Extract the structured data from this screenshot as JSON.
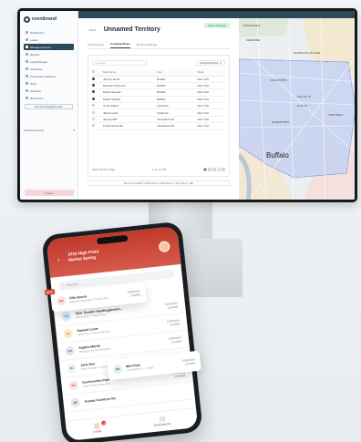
{
  "app": {
    "brand": "eventbrand",
    "sidebar_items": [
      {
        "label": "Dashboard",
        "active": false
      },
      {
        "label": "Leads",
        "active": false
      },
      {
        "label": "Manage Account",
        "active": true
      },
      {
        "label": "Reports",
        "active": false
      },
      {
        "label": "Lead Manager",
        "active": false
      },
      {
        "label": "Attendees",
        "active": false
      },
      {
        "label": "Processed Invitations",
        "active": false
      },
      {
        "label": "Tests",
        "active": false
      },
      {
        "label": "Activities",
        "active": false
      },
      {
        "label": "Resources",
        "active": false
      }
    ],
    "sidebar_button": "Set Up Integration Hub",
    "sidebar_select": "Switch Accounts",
    "logout_label": "Logout",
    "back_label": "< Back",
    "page_title": "Unnamed Territory",
    "save_label": "Save Changes",
    "tabs": [
      {
        "label": "Territory Area",
        "active": false
      },
      {
        "label": "Assigned Reps",
        "active": true
      },
      {
        "label": "Territory Settings",
        "active": false
      }
    ],
    "search_placeholder": "Search",
    "filter_label": "Assigned Reps",
    "columns": [
      "Rep Name",
      "City",
      "State"
    ],
    "rows": [
      {
        "checked": true,
        "name": "Jeremy Smith",
        "city": "Buffalo",
        "state": "New York"
      },
      {
        "checked": true,
        "name": "Brandon Simmons",
        "city": "Buffalo",
        "state": "New York"
      },
      {
        "checked": true,
        "name": "Daniel Stewart",
        "city": "Buffalo",
        "state": "New York"
      },
      {
        "checked": true,
        "name": "Kaitlin Stewart",
        "city": "Buffalo",
        "state": "New York"
      },
      {
        "checked": false,
        "name": "Corey Parker",
        "city": "Syracuse",
        "state": "New York"
      },
      {
        "checked": false,
        "name": "Jacob Lewis",
        "city": "Syracuse",
        "state": "New York"
      },
      {
        "checked": false,
        "name": "Jeremy Bell",
        "city": "Cleveland Hill",
        "state": "New York"
      },
      {
        "checked": false,
        "name": "Lorilei Alexander",
        "city": "Cleveland Hill",
        "state": "New York"
      }
    ],
    "pager_show": "Show",
    "pager_per_page": "10",
    "pager_per_page_label": "Per Page",
    "pager_count": "1-10 of 126",
    "pages": [
      "1",
      "2",
      "3",
      "...",
      "8"
    ],
    "hint": "Rep Not Listed? Click here to add them to \"My Reps\" Tab",
    "map_city": "Buffalo",
    "map_labels": [
      "TONAWANDA",
      "KENMORE",
      "ELMWOOD VILLAGE",
      "FIVE POINTS",
      "Summer St",
      "North St",
      "TRUE BELT",
      "ALLENTOWN"
    ]
  },
  "phone": {
    "title_line1": "3723 High Point",
    "title_line2": "Market Spring",
    "search_placeholder": "Search...",
    "items": [
      {
        "initials": "TS",
        "name": "Tyler Gunder Handingbersen...",
        "sub": "Sales Agent / Product Rep",
        "time": "10/08/2024",
        "time2": "10:30AM",
        "color": "#dbe8f7",
        "ink": "#3b6ea5"
      },
      {
        "initials": "SL",
        "name": "Samuel Loser",
        "sub": "Sales Rep / Product Manager",
        "time": "10/08/2024",
        "time2": "10:30AM",
        "color": "#fde9c8",
        "ink": "#b7791f"
      },
      {
        "initials": "SM",
        "name": "Sophie Martin",
        "sub": "Manager / Territory Manager",
        "time": "10/08/2024",
        "time2": "10:30AM",
        "color": "#e7e2f7",
        "ink": "#6b56b0"
      },
      {
        "initials": "JD",
        "name": "Jane Doe",
        "sub": "Sales Manager / Product Rep",
        "time": "10/08/2024",
        "time2": "10:30AM",
        "color": "#f0f2f4",
        "ink": "#4b5563"
      },
      {
        "initials": "KP",
        "name": "Kevinvenkin Park",
        "sub": "Super Senior Sales Rep",
        "time": "10/08/2024",
        "time2": "10:30AM",
        "color": "#fde2e0",
        "ink": "#c0392b"
      },
      {
        "initials": "AF",
        "name": "Acasta Furniture Inc.",
        "sub": "",
        "time": "",
        "time2": "",
        "color": "#e5e7eb",
        "ink": "#374151"
      }
    ],
    "tabs": [
      "Leads",
      "Notifications"
    ],
    "badge": "3"
  },
  "cards": {
    "card1": {
      "tag": "NEW",
      "initials": "OG",
      "name": "Olin Garcia",
      "sub": "Marketing Specialist / Product Rep",
      "time": "10/08/2024",
      "time2": "10:30AM"
    },
    "card2": {
      "initials": "MC",
      "name": "Mai Chan",
      "sub": "Is interested in... Ontario",
      "time": "10/08/2024",
      "time2": "10:30AM"
    }
  },
  "colors": {
    "brand_dark": "#2d4a5a",
    "accent_red": "#c0392b",
    "map_region": "#c9d4f2"
  }
}
